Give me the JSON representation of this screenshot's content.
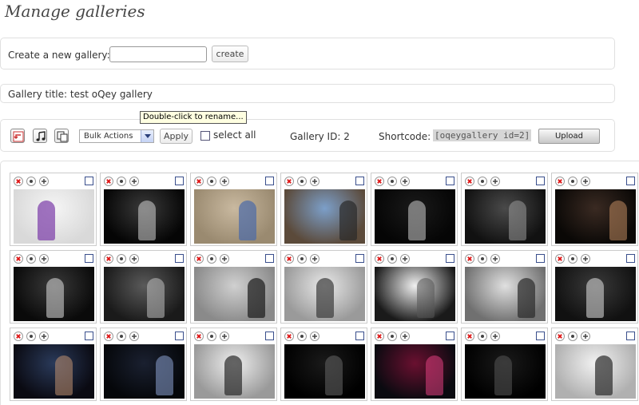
{
  "page": {
    "title": "Manage galleries"
  },
  "create": {
    "label": "Create a new gallery:",
    "input_value": "",
    "button_label": "create"
  },
  "gallery": {
    "title_text": "Gallery title: test oQey gallery",
    "tooltip": "Double-click to rename...",
    "id_text": "Gallery ID: 2",
    "shortcode_label": "Shortcode:",
    "shortcode_value": "[oqeygallery id=2]"
  },
  "toolbar": {
    "tools": [
      {
        "icon": "undo-icon"
      },
      {
        "icon": "music-icon"
      },
      {
        "icon": "copy-icon"
      }
    ],
    "bulk_select": "Bulk Actions",
    "apply_label": "Apply",
    "select_all_label": "select all",
    "upload_label": "Upload"
  },
  "thumb_controls": [
    "delete-icon",
    "details-icon",
    "add-icon"
  ],
  "photos": [
    {
      "tone": [
        "#f5f5f5",
        "#d9d9d9"
      ],
      "hl": "#7a3aa8",
      "dark": false
    },
    {
      "tone": [
        "#3a3a3a",
        "#050505"
      ],
      "hl": "#cfcfcf",
      "dark": true
    },
    {
      "tone": [
        "#c9b9a0",
        "#9a8a70"
      ],
      "hl": "#4a6aa8",
      "dark": false
    },
    {
      "tone": [
        "#7c9fc9",
        "#5b4a3a"
      ],
      "hl": "#2a2a2a",
      "dark": false
    },
    {
      "tone": [
        "#1a1a1a",
        "#050505"
      ],
      "hl": "#cccccc",
      "dark": true
    },
    {
      "tone": [
        "#4a4a4a",
        "#111111"
      ],
      "hl": "#999999",
      "dark": true
    },
    {
      "tone": [
        "#3a2a22",
        "#0a0806"
      ],
      "hl": "#c08a60",
      "dark": true
    },
    {
      "tone": [
        "#3a3a3a",
        "#0a0a0a"
      ],
      "hl": "#dddddd",
      "dark": true
    },
    {
      "tone": [
        "#5a5a5a",
        "#1a1a1a"
      ],
      "hl": "#bdbdbd",
      "dark": true
    },
    {
      "tone": [
        "#d0d0d0",
        "#8a8a8a"
      ],
      "hl": "#1a1a1a",
      "dark": false
    },
    {
      "tone": [
        "#e8e8e8",
        "#9a9a9a"
      ],
      "hl": "#3a3a3a",
      "dark": false
    },
    {
      "tone": [
        "#f0f0f0",
        "#1a1a1a"
      ],
      "hl": "#555555",
      "dark": true
    },
    {
      "tone": [
        "#e0e0e0",
        "#707070"
      ],
      "hl": "#2a2a2a",
      "dark": false
    },
    {
      "tone": [
        "#3a3a3a",
        "#111111"
      ],
      "hl": "#e0e0e0",
      "dark": true
    },
    {
      "tone": [
        "#2a3a5a",
        "#0a0a12"
      ],
      "hl": "#c09070",
      "dark": true
    },
    {
      "tone": [
        "#1a2030",
        "#05070a"
      ],
      "hl": "#8aa0d0",
      "dark": true
    },
    {
      "tone": [
        "#eeeeee",
        "#9a9a9a"
      ],
      "hl": "#2a2a2a",
      "dark": false
    },
    {
      "tone": [
        "#1a1a1a",
        "#000000"
      ],
      "hl": "#666666",
      "dark": true
    },
    {
      "tone": [
        "#6a1030",
        "#0a0a10"
      ],
      "hl": "#e04080",
      "dark": true
    },
    {
      "tone": [
        "#1a1a1a",
        "#000000"
      ],
      "hl": "#555555",
      "dark": true
    },
    {
      "tone": [
        "#f2f2f2",
        "#b0b0b0"
      ],
      "hl": "#2a2a2a",
      "dark": false
    }
  ]
}
